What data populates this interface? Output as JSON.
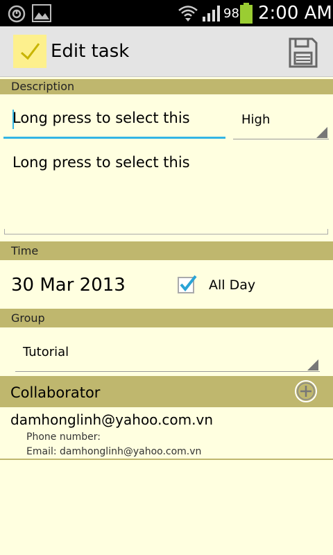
{
  "status_bar": {
    "icons": [
      "power-icon",
      "image-icon",
      "wifi-icon",
      "signal-icon",
      "battery-icon"
    ],
    "battery_percent": "98",
    "time": "2:00 AM"
  },
  "action_bar": {
    "title": "Edit task",
    "app_icon": "checkmark-icon",
    "save_icon": "save-icon"
  },
  "description": {
    "header": "Description",
    "title_value": "Long press to select this",
    "priority": "High",
    "notes_value": "Long press to select this"
  },
  "time": {
    "header": "Time",
    "date": "30 Mar 2013",
    "all_day_label": "All Day",
    "all_day_checked": true
  },
  "group": {
    "header": "Group",
    "selected": "Tutorial"
  },
  "collaborator": {
    "header": "Collaborator",
    "add_icon": "add-circle-icon",
    "items": [
      {
        "email": "damhonglinh@yahoo.com.vn",
        "phone_line": "Phone number:",
        "email_line": "Email: damhonglinh@yahoo.com.vn"
      }
    ]
  },
  "colors": {
    "background": "#ffffe0",
    "section_header": "#bfb76e",
    "accent": "#33b5e5",
    "action_bar": "#e4e4e4"
  }
}
